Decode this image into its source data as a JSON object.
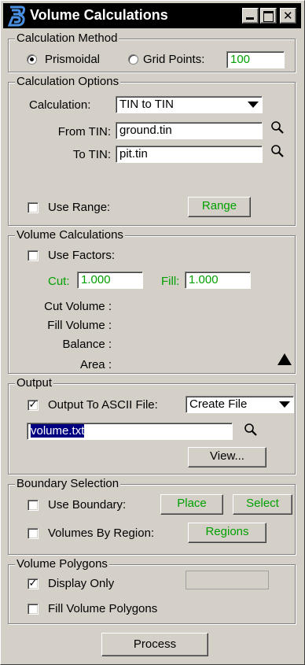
{
  "window": {
    "title": "Volume Calculations"
  },
  "calc_method": {
    "legend": "Calculation Method",
    "prismoidal_label": "Prismoidal",
    "prismoidal_selected": true,
    "grid_label": "Grid Points:",
    "grid_value": "100"
  },
  "calc_options": {
    "legend": "Calculation Options",
    "calculation_label": "Calculation:",
    "calculation_value": "TIN to TIN",
    "from_label": "From TIN:",
    "from_value": "ground.tin",
    "to_label": "To TIN:",
    "to_value": "pit.tin",
    "use_range_label": "Use Range:",
    "range_button": "Range"
  },
  "volume_calcs": {
    "legend": "Volume Calculations",
    "use_factors_label": "Use Factors:",
    "cut_label": "Cut:",
    "cut_value": "1.000",
    "fill_label": "Fill:",
    "fill_value": "1.000",
    "cut_volume_label": "Cut Volume :",
    "fill_volume_label": "Fill Volume :",
    "balance_label": "Balance :",
    "area_label": "Area :"
  },
  "output": {
    "legend": "Output",
    "ascii_label": "Output To ASCII File:",
    "ascii_checked": true,
    "mode_value": "Create File",
    "file_value": "volume.txt",
    "view_button": "View..."
  },
  "boundary": {
    "legend": "Boundary Selection",
    "use_boundary_label": "Use Boundary:",
    "place_button": "Place",
    "select_button": "Select",
    "by_region_label": "Volumes By Region:",
    "regions_button": "Regions"
  },
  "polygons": {
    "legend": "Volume Polygons",
    "display_only_label": "Display Only",
    "display_only_checked": true,
    "fill_polygons_label": "Fill Volume Polygons"
  },
  "process_button": "Process",
  "icons": {
    "app": "bentley-b-icon",
    "search": "magnifier-icon"
  },
  "colors": {
    "title_bg": "#000000",
    "face": "#d4d0c8",
    "active_text": "#00a000",
    "selection": "#000080"
  }
}
